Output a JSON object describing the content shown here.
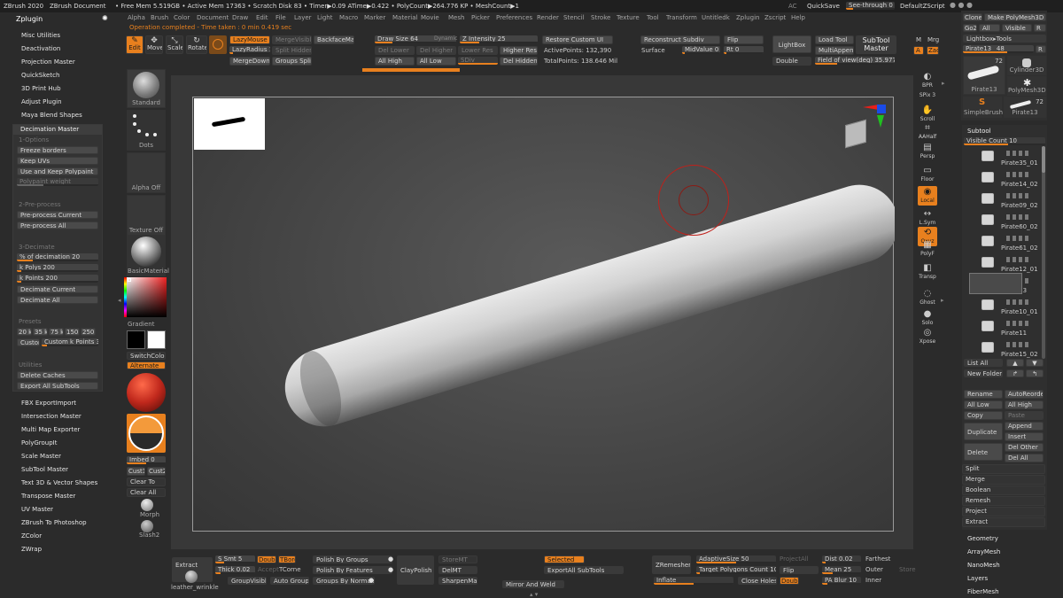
{
  "titlebar": {
    "app": "ZBrush 2020",
    "doc": "ZBrush Document",
    "stats": "• Free Mem 5.519GB • Active Mem 17363 • Scratch Disk 83 • Timer▶0.09 ATime▶0.422 • PolyCount▶264.776 KP • MeshCount▶1",
    "ac": "AC",
    "quicksave": "QuickSave",
    "seethrough": "See-through",
    "seethrough_val": "0",
    "default_zscript": "DefaultZScript"
  },
  "menubar": [
    "Alpha",
    "Brush",
    "Color",
    "Document",
    "Draw",
    "Edit",
    "File",
    "Layer",
    "Light",
    "Macro",
    "Marker",
    "Material",
    "Movie",
    "Mesh",
    "Picker",
    "Preferences",
    "Render",
    "Stencil",
    "Stroke",
    "Texture",
    "Tool",
    "Transform",
    "Untitledk",
    "Zplugin",
    "Zscript",
    "Help"
  ],
  "status": "Operation completed - Time taken : 0 min 0.419 sec",
  "modes": {
    "edit": "Edit",
    "move": "Move",
    "scale": "Scale",
    "rotate": "Rotate"
  },
  "toolbar": {
    "lazymouse": "LazyMouse",
    "lazyradius": "LazyRadius 1",
    "mergedown": "MergeDown",
    "mergevisible": "MergeVisible",
    "split_hidden": "Split Hidden",
    "groups_split": "Groups Split",
    "backfacemask": "BackfaceMask",
    "draw_size": "Draw Size 64",
    "dynamic": "Dynamic",
    "z_intensity": "Z Intensity 25",
    "del_lower": "Del Lower",
    "del_higher": "Del Higher",
    "all_high": "All High",
    "all_low": "All Low",
    "lower_res": "Lower Res",
    "higher_res": "Higher Res",
    "sdiv": "SDiv",
    "del_hidden": "Del Hidden",
    "restore_custom_ui": "Restore Custom UI",
    "active_points": "ActivePoints: 132,390",
    "total_points": "TotalPoints: 138.646 Mil",
    "reconstruct_subdiv": "Reconstruct Subdiv",
    "surface": "Surface",
    "midvalue": "MidValue 0",
    "flip": "Flip",
    "rt": "Rt 0",
    "lightbox": "LightBox",
    "double": "Double",
    "load_tool": "Load Tool",
    "multiappend": "MultiAppend",
    "field_of_view": "Field of view(deg) 35.9775",
    "subtool_master_1": "SubTool",
    "subtool_master_2": "Master",
    "m": "M",
    "mrg": "Mrg",
    "a": "A",
    "zadd": "Zadd"
  },
  "zplugin": {
    "title": "Zplugin",
    "items_top": [
      "Misc Utilities",
      "Deactivation",
      "Projection Master",
      "QuickSketch",
      "3D Print Hub",
      "Adjust Plugin",
      "Maya Blend Shapes",
      "Decimation Master"
    ],
    "options_header": "1-Options",
    "freeze_borders": "Freeze borders",
    "keep_uvs": "Keep UVs",
    "use_keep_polypaint": "Use and Keep Polypaint",
    "polypaint_weight": "Polypaint weight",
    "preprocess_header": "2-Pre-process",
    "preprocess_current": "Pre-process Current",
    "preprocess_all": "Pre-process All",
    "decimate_header": "3-Decimate",
    "pct_decimation": "% of decimation 20",
    "k_polys": "k Polys 200",
    "k_points": "k Points 200",
    "decimate_current": "Decimate Current",
    "decimate_all": "Decimate All",
    "presets_header": "Presets",
    "presets": [
      "20 k",
      "35 k",
      "75 k",
      "150 k",
      "250 k"
    ],
    "custom": "Custom",
    "custom_k_points": "Custom k Points 30",
    "utilities_header": "Utilities",
    "delete_caches": "Delete Caches",
    "export_all_subtools": "Export All SubTools",
    "items_bottom": [
      "FBX ExportImport",
      "Intersection Master",
      "Multi Map Exporter",
      "PolyGroupIt",
      "Scale Master",
      "SubTool Master",
      "Text 3D & Vector Shapes",
      "Transpose Master",
      "UV Master",
      "ZBrush To Photoshop",
      "ZColor",
      "ZWrap"
    ]
  },
  "brushshelf": {
    "standard": "Standard",
    "dots": "Dots",
    "alpha_off": "Alpha Off",
    "texture_off": "Texture Off",
    "material": "BasicMaterial",
    "gradient": "Gradient",
    "switchcolor": "SwitchColor",
    "alternate": "Alternate",
    "imbed": "Imbed 0",
    "cust1": "Cust1",
    "cust2": "Cust2",
    "clear_to": "Clear To",
    "clear_all": "Clear All",
    "morph": "Morph",
    "slash2": "Slash2"
  },
  "right_icons": [
    "BPR",
    "SPix 3",
    "Scroll",
    "AAHalf",
    "Persp",
    "Floor",
    "Local",
    "L.Sym",
    "Qxyz",
    "PolyF",
    "Transp",
    "Ghost",
    "Solo",
    "Xpose"
  ],
  "toolpanel": {
    "clone": "Clone",
    "make_polymesh3d": "Make PolyMesh3D",
    "goz": "GoZ",
    "all": "All",
    "visible": "Visible",
    "r": "R",
    "lightbox_tools": "Lightbox▸Tools",
    "pirate_slider": "Pirate13_ 48",
    "r2": "R",
    "thumbs": [
      {
        "name": "Pirate13",
        "count": "72"
      },
      {
        "name": "Cylinder3D",
        "count": ""
      },
      {
        "name": "PolyMesh3D",
        "count": ""
      },
      {
        "name": "SimpleBrush",
        "count": ""
      },
      {
        "name": "Pirate13",
        "count": "72"
      }
    ]
  },
  "subtool": {
    "title": "Subtool",
    "visible_count": "Visible Count 10",
    "items": [
      "Pirate35_01",
      "Pirate14_02",
      "Pirate09_02",
      "Pirate60_02",
      "Pirate61_02",
      "Pirate12_01",
      "Pirate13",
      "Pirate10_01",
      "Pirate11",
      "Pirate15_02"
    ],
    "list_all": "List All",
    "new_folder": "New Folder",
    "rename": "Rename",
    "autoreorder": "AutoReorder",
    "all_low": "All Low",
    "all_high": "All High",
    "copy": "Copy",
    "paste": "Paste",
    "duplicate": "Duplicate",
    "append": "Append",
    "insert": "Insert",
    "delete": "Delete",
    "del_other": "Del Other",
    "del_all": "Del All",
    "sections": [
      "Split",
      "Merge",
      "Boolean",
      "Remesh",
      "Project",
      "Extract"
    ],
    "lower": [
      "Geometry",
      "ArrayMesh",
      "NanoMesh",
      "Layers",
      "FiberMesh"
    ]
  },
  "bottom": {
    "extract": "Extract",
    "leather_wrinkle": "leather_wrinkle",
    "s_smt": "S Smt 5",
    "double": "Double",
    "tbord": "TBord",
    "thick": "Thick 0.02",
    "accept": "Accept",
    "tcorne": "TCorne",
    "groupvisible": "GroupVisible",
    "auto_groups": "Auto Groups",
    "polish_by_groups": "Polish By Groups",
    "polish_by_features": "Polish By Features",
    "groups_by_normals": "Groups By Normals",
    "claypolish": "ClayPolish",
    "storemt": "StoreMT",
    "delmt": "DelMT",
    "sharpenmask": "SharpenMask",
    "mirror_and_weld": "Mirror And Weld",
    "selected": "Selected",
    "export_all_subtools": "ExportAll SubTools",
    "zremesher": "ZRemesher",
    "adaptivesize": "AdaptiveSize 50",
    "target_polygons": "Target Polygons Count 10",
    "inflate": "Inflate",
    "projectall": "ProjectAll",
    "flip": "Flip",
    "close_holes": "Close Holes",
    "double2": "Double",
    "dist": "Dist 0.02",
    "mean": "Mean 25",
    "pa_blur": "PA Blur 10",
    "farthest": "Farthest",
    "outer": "Outer",
    "inner": "Inner",
    "store": "Store"
  }
}
